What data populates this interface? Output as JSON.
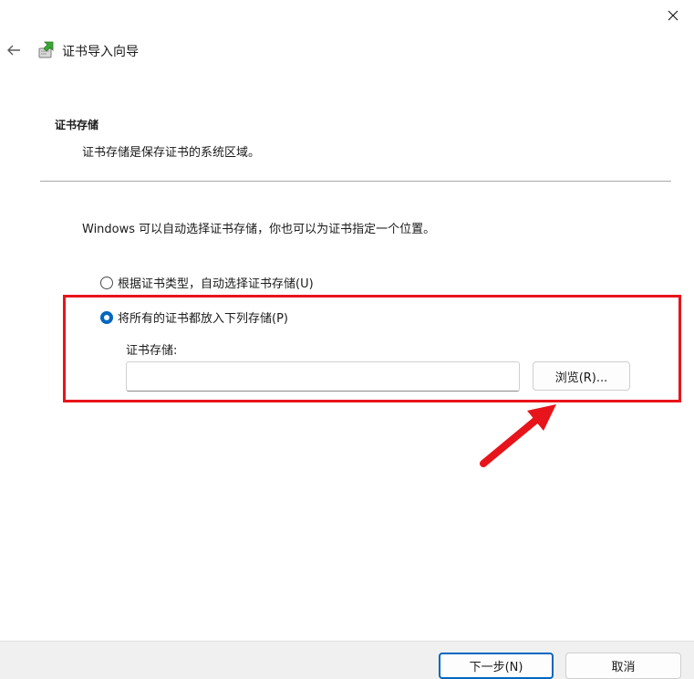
{
  "window": {
    "title": "证书导入向导"
  },
  "section": {
    "header": "证书存储",
    "description": "证书存储是保存证书的系统区域。"
  },
  "info_text": "Windows 可以自动选择证书存储，你也可以为证书指定一个位置。",
  "options": [
    {
      "label": "根据证书类型，自动选择证书存储(U)",
      "checked": false
    },
    {
      "label": "将所有的证书都放入下列存储(P)",
      "checked": true
    }
  ],
  "store": {
    "label": "证书存储:",
    "value": "",
    "browse_label": "浏览(R)..."
  },
  "footer": {
    "next_label": "下一步(N)",
    "cancel_label": "取消"
  },
  "colors": {
    "accent": "#0067c0",
    "highlight": "#e8141b"
  }
}
